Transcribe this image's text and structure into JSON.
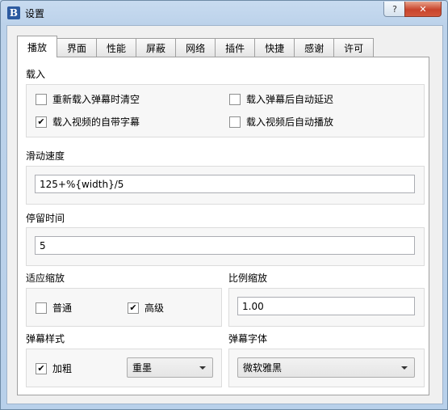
{
  "window": {
    "title": "设置",
    "logo_letter": "B",
    "help_glyph": "?",
    "close_glyph": "✕"
  },
  "tabs": [
    "播放",
    "界面",
    "性能",
    "屏蔽",
    "网络",
    "插件",
    "快捷",
    "感谢",
    "许可"
  ],
  "load": {
    "title": "载入",
    "options": [
      {
        "label": "重新载入弹幕时清空",
        "checked": false
      },
      {
        "label": "载入弹幕后自动延迟",
        "checked": false
      },
      {
        "label": "载入视频的自带字幕",
        "checked": true
      },
      {
        "label": "载入视频后自动播放",
        "checked": false
      }
    ]
  },
  "scroll_speed": {
    "title": "滑动速度",
    "value": "125+%{width}/5"
  },
  "stay_time": {
    "title": "停留时间",
    "value": "5"
  },
  "adapt_scale": {
    "title": "适应缩放",
    "options": [
      {
        "label": "普通",
        "checked": false
      },
      {
        "label": "高级",
        "checked": true
      }
    ]
  },
  "ratio_scale": {
    "title": "比例缩放",
    "value": "1.00"
  },
  "danmaku_style": {
    "title": "弹幕样式",
    "bold": {
      "label": "加粗",
      "checked": true
    },
    "effect_select": "重墨"
  },
  "danmaku_font": {
    "title": "弹幕字体",
    "font_select": "微软雅黑"
  },
  "check_glyph": "✔"
}
